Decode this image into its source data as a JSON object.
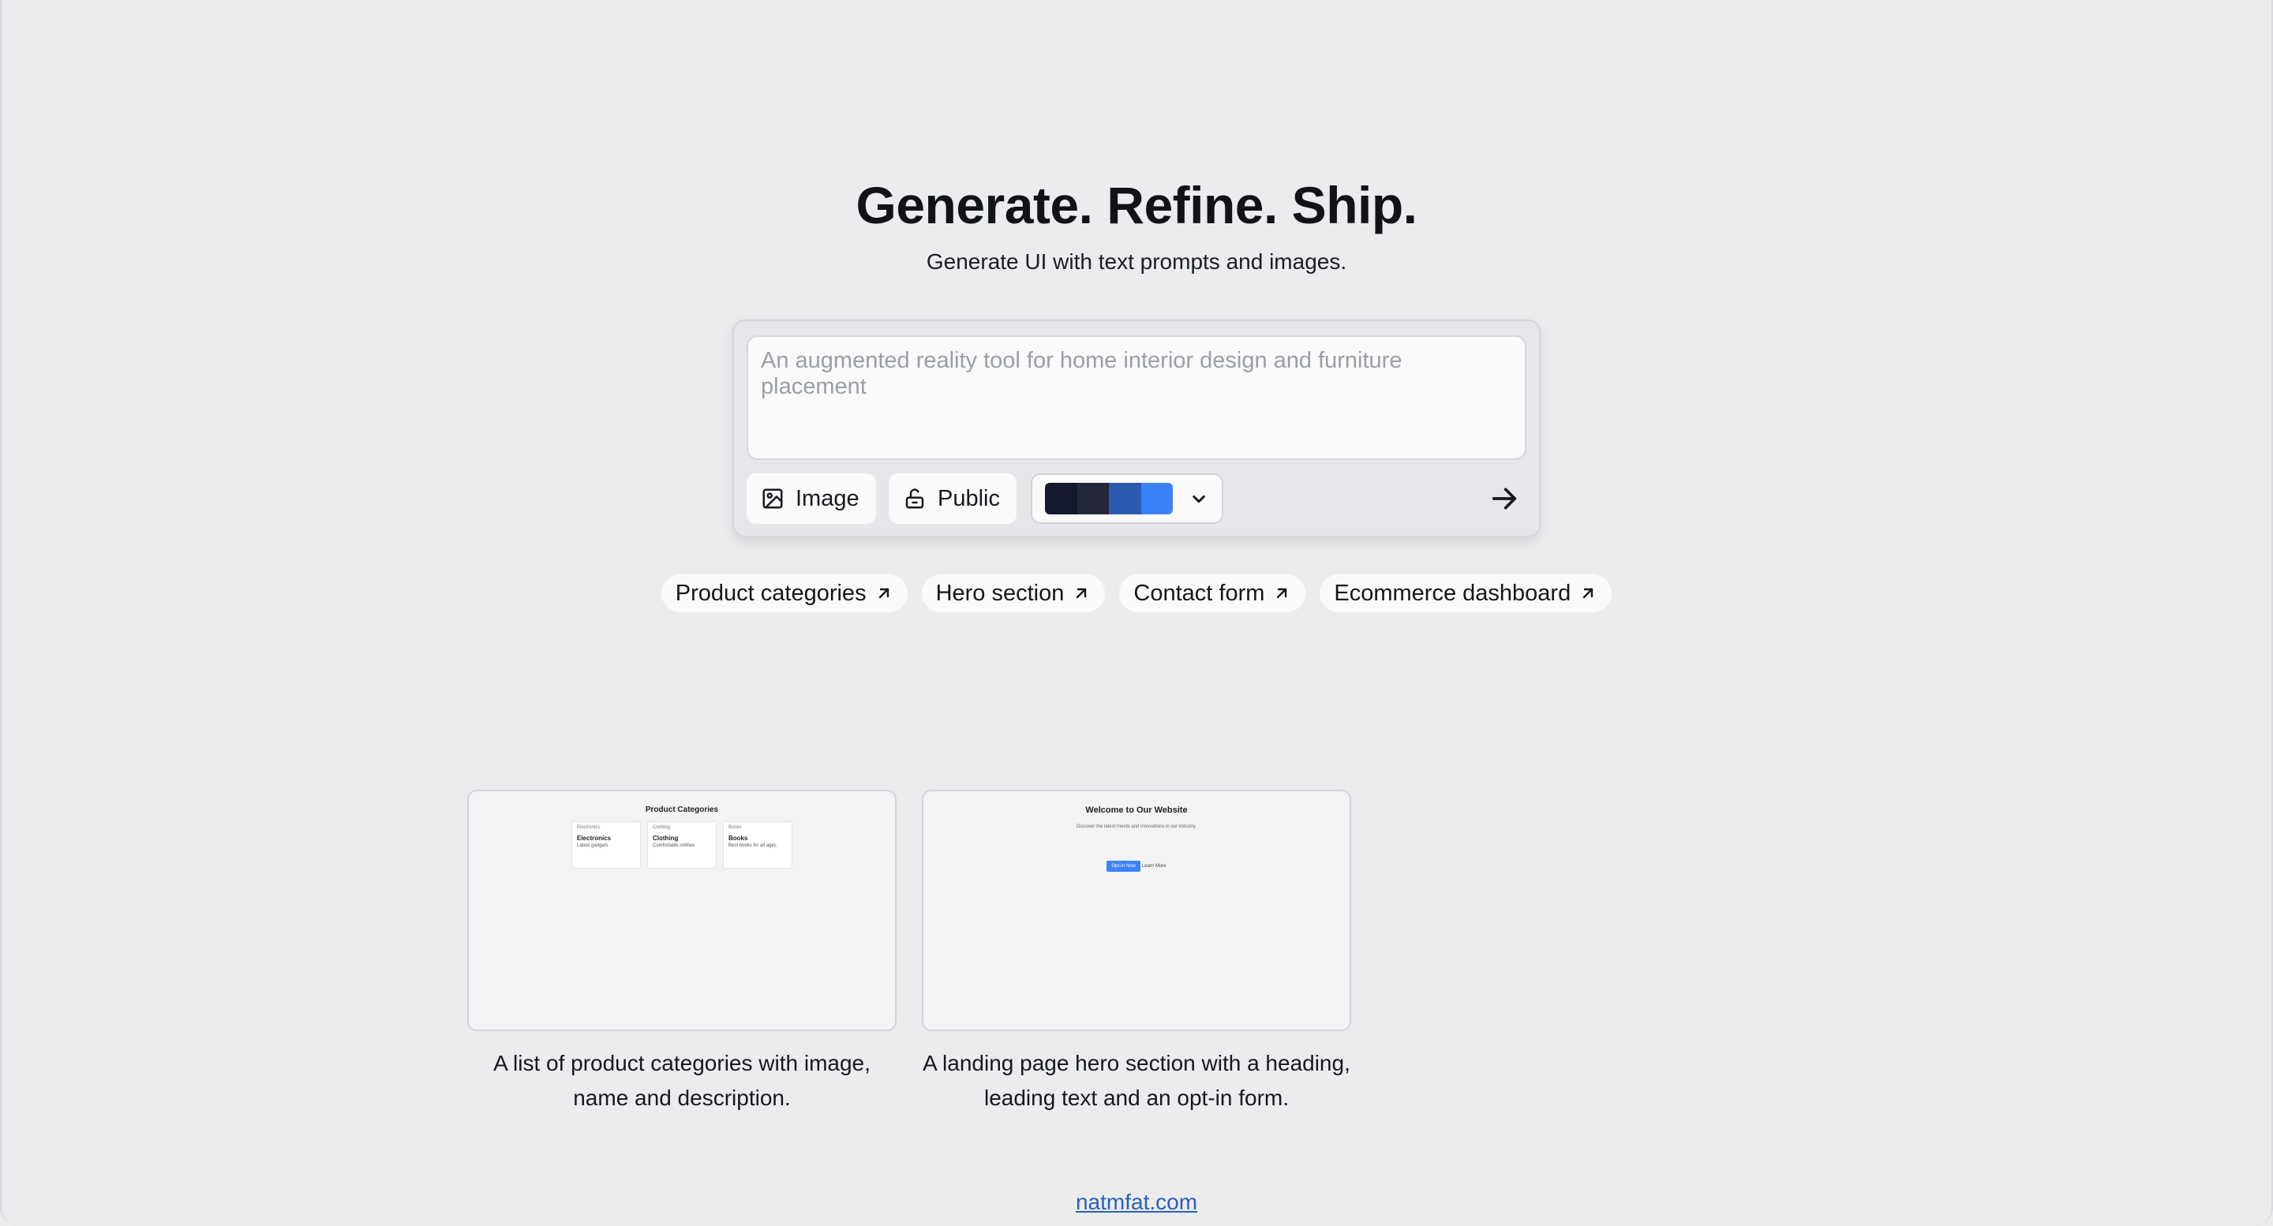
{
  "hero": {
    "title": "Generate. Refine. Ship.",
    "subtitle": "Generate UI with text prompts and images."
  },
  "composer": {
    "placeholder": "An augmented reality tool for home interior design and furniture placement",
    "image_button": "Image",
    "visibility_button": "Public",
    "theme_swatches": [
      "#141a2b",
      "#222838",
      "#2a5bb0",
      "#3b82f6"
    ]
  },
  "suggestions": [
    {
      "label": "Product categories"
    },
    {
      "label": "Hero section"
    },
    {
      "label": "Contact form"
    },
    {
      "label": "Ecommerce dashboard"
    }
  ],
  "examples": [
    {
      "caption": "A list of product categories with image, name and description.",
      "preview": {
        "title": "Product Categories",
        "tiles": [
          {
            "alt": "Electronics",
            "name": "Electronics",
            "desc": "Latest gadgets"
          },
          {
            "alt": "Clothing",
            "name": "Clothing",
            "desc": "Comfortable clothes"
          },
          {
            "alt": "Books",
            "name": "Books",
            "desc": "Best books for all ages"
          }
        ]
      }
    },
    {
      "caption": "A landing page hero section with a heading, leading text and an opt-in form.",
      "preview": {
        "title": "Welcome to Our Website",
        "subtitle": "Discover the latest trends and innovations in our industry.",
        "button": "Opt-In Now",
        "link": "Learn More"
      }
    }
  ],
  "footer": {
    "link": "natmfat.com"
  }
}
